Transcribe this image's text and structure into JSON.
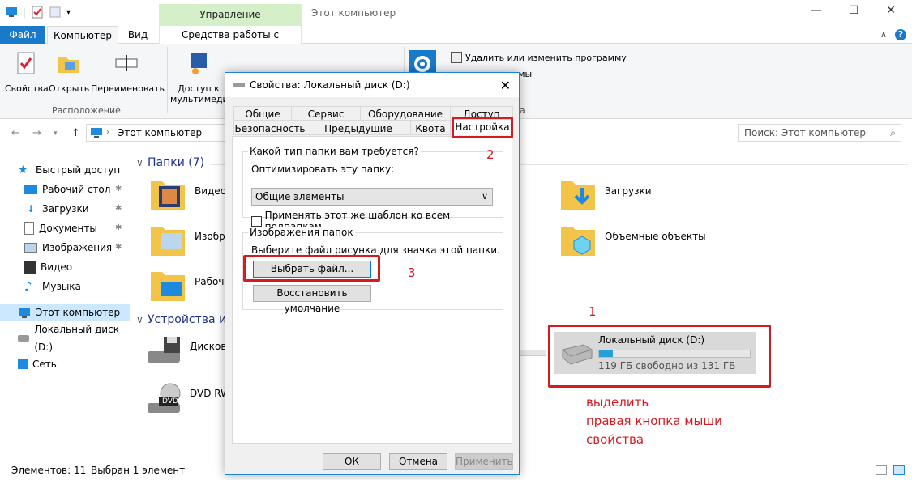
{
  "window": {
    "title": "Этот компьютер",
    "context_group": "Управление",
    "minimize": "—",
    "maximize": "☐",
    "close": "✕"
  },
  "ribbon_tabs": {
    "file": "Файл",
    "computer": "Компьютер",
    "view": "Вид",
    "disk_tools": "Средства работы с дисками"
  },
  "ribbon": {
    "properties": "Свойства",
    "open": "Открыть",
    "rename": "Переименовать",
    "group_location": "Расположение",
    "media_access_1": "Доступ к",
    "media_access_2": "мультимеди",
    "uninstall": "Удалить или изменить программу",
    "system_props": "Свойства системы",
    "system_partial": "стемы",
    "group_a": "а"
  },
  "address": {
    "path": "Этот компьютер",
    "search_placeholder": "Поиск: Этот компьютер"
  },
  "sidebar": {
    "items": [
      {
        "label": "Быстрый доступ"
      },
      {
        "label": "Рабочий стол"
      },
      {
        "label": "Загрузки"
      },
      {
        "label": "Документы"
      },
      {
        "label": "Изображения"
      },
      {
        "label": "Видео"
      },
      {
        "label": "Музыка"
      },
      {
        "label": "Этот компьютер"
      },
      {
        "label": "Локальный диск (D:)"
      },
      {
        "label": "Сеть"
      }
    ]
  },
  "main": {
    "folders_section": "Папки (7)",
    "devices_section": "Устройства и д",
    "folders": {
      "video": "Видео",
      "images": "Изображ",
      "desktop": "Рабочий",
      "downloads": "Загрузки",
      "objects3d": "Объемные объекты"
    },
    "devices": {
      "disk": "Дисково",
      "dvd": "DVD RW",
      "dvd_badge": "DVD"
    },
    "drive": {
      "name": "Локальный диск (D:)",
      "free": "119 ГБ свободно из 131 ГБ",
      "used_fraction": 0.09
    }
  },
  "status": {
    "items": "Элементов: 11",
    "selected": "Выбран 1 элемент"
  },
  "dialog": {
    "title": "Свойства: Локальный диск (D:)",
    "close": "✕",
    "tabs_row1": [
      "Общие",
      "Сервис",
      "Оборудование",
      "Доступ"
    ],
    "tabs_row2": [
      "Безопасность",
      "Предыдущие версии",
      "Квота",
      "Настройка"
    ],
    "folder_type_legend": "Какой тип папки вам требуется?",
    "optimize_label": "Оптимизировать эту папку:",
    "optimize_value": "Общие элементы",
    "apply_subfolders": "Применять этот же шаблон ко всем подпапкам",
    "folder_images_legend": "Изображения папок",
    "choose_file_desc": "Выберите файл рисунка для значка этой папки.",
    "choose_file_btn": "Выбрать файл...",
    "restore_default_btn": "Восстановить умолчание",
    "ok": "ОК",
    "cancel": "Отмена",
    "apply": "Применить"
  },
  "annotations": {
    "num1": "1",
    "num2": "2",
    "num3": "3",
    "line1": "выделить",
    "line2": "правая кнопка мыши",
    "line3": "свойства"
  },
  "colors": {
    "accent": "#1979ca",
    "annotation": "#d71920",
    "context_green": "#d5f0c9",
    "progress": "#26a0da"
  }
}
